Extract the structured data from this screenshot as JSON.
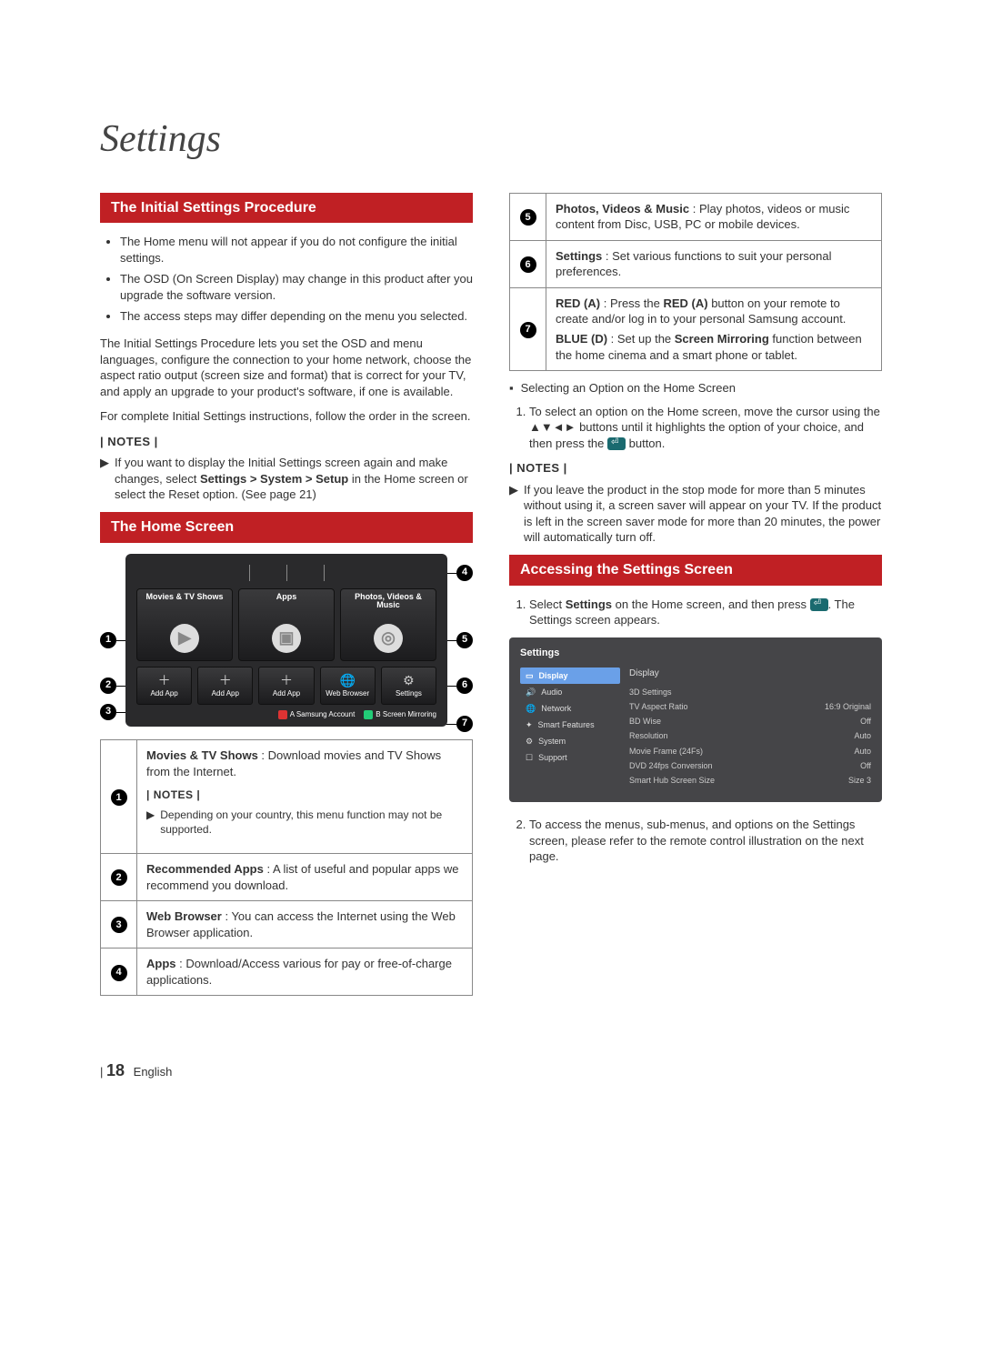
{
  "chapter": "Settings",
  "left": {
    "section1_title": "The Initial Settings Procedure",
    "bullets": [
      "The Home menu will not appear if you do not configure the initial settings.",
      "The OSD (On Screen Display) may change in this product after you upgrade the software version.",
      "The access steps may differ depending on the menu you selected."
    ],
    "para1": "The Initial Settings Procedure lets you set the OSD and menu languages, configure the connection to your home network, choose the aspect ratio output (screen size and format) that is correct for your TV, and apply an upgrade to your product's software, if one is available.",
    "para2": "For complete Initial Settings instructions, follow the order in the screen.",
    "notes_label": "| NOTES |",
    "note1a": "If you want to display the Initial Settings screen again and make changes, select ",
    "note1b": "Settings > System > Setup",
    "note1c": " in the Home screen or select the Reset option. (See page 21)",
    "section2_title": "The Home Screen",
    "home_cards": {
      "c1": "Movies & TV Shows",
      "c2": "Apps",
      "c3": "Photos, Videos & Music"
    },
    "home_small": {
      "s1": "Add App",
      "s2": "Add App",
      "s3": "Add App",
      "s4": "Web Browser",
      "s5": "Settings"
    },
    "home_bottom": {
      "a": "Samsung Account",
      "b": "Screen Mirroring"
    },
    "callouts": {
      "c1": "1",
      "c2": "2",
      "c3": "3",
      "c4": "4",
      "c5": "5",
      "c6": "6",
      "c7": "7"
    },
    "table": {
      "r1_lead": "Movies & TV Shows",
      "r1_rest": " : Download movies and TV Shows from the Internet.",
      "r1_notes_label": "| NOTES |",
      "r1_note": "Depending on your country, this menu function may not be supported.",
      "r2_lead": "Recommended Apps",
      "r2_rest": " : A list of useful and popular apps we recommend you download.",
      "r3_lead": "Web Browser",
      "r3_rest": " : You can access the Internet using the Web Browser application.",
      "r4_lead": "Apps",
      "r4_rest": " : Download/Access various for pay or free-of-charge applications."
    }
  },
  "right": {
    "table2": {
      "r5_lead": "Photos, Videos & Music",
      "r5_rest": " : Play photos, videos or music content from Disc, USB, PC or mobile devices.",
      "r6_lead": "Settings",
      "r6_rest": " : Set various functions to suit your personal preferences.",
      "r7_a_lead": "RED (A)",
      "r7_a_mid": " : Press the ",
      "r7_a_btn": "RED (A)",
      "r7_a_rest": " button on your remote to create and/or log in to your personal Samsung account.",
      "r7_b_lead": "BLUE (D)",
      "r7_b_mid": " : Set up the ",
      "r7_b_btn": "Screen Mirroring",
      "r7_b_rest": " function between the home cinema and a smart phone or tablet."
    },
    "sel_heading": "Selecting an Option on the Home Screen",
    "step1a": "To select an option on the Home screen, move the cursor using the ▲▼◄► buttons until it highlights the option of your choice, and then press the ",
    "step1b": " button.",
    "notes_label": "| NOTES |",
    "note2": "If you leave the product in the stop mode for more than 5 minutes without using it, a screen saver will appear on your TV. If the product is left in the screen saver mode for more than 20 minutes, the power will automatically turn off.",
    "section3_title": "Accessing the Settings Screen",
    "acc_step1a": "Select ",
    "acc_step1b": "Settings",
    "acc_step1c": " on the Home screen, and then press ",
    "acc_step1d": ". The Settings screen appears.",
    "settings_ui": {
      "title": "Settings",
      "panel": "Display",
      "nav": [
        "Display",
        "Audio",
        "Network",
        "Smart Features",
        "System",
        "Support"
      ],
      "rows": [
        {
          "l": "3D Settings",
          "v": ""
        },
        {
          "l": "TV Aspect Ratio",
          "v": "16:9 Original"
        },
        {
          "l": "BD Wise",
          "v": "Off"
        },
        {
          "l": "Resolution",
          "v": "Auto"
        },
        {
          "l": "Movie Frame (24Fs)",
          "v": "Auto"
        },
        {
          "l": "DVD 24fps Conversion",
          "v": "Off"
        },
        {
          "l": "Smart Hub Screen Size",
          "v": "Size 3"
        }
      ]
    },
    "acc_step2": "To access the menus, sub-menus, and options on the Settings screen, please refer to the remote control illustration on the next page."
  },
  "footer": {
    "page": "18",
    "lang": "English"
  }
}
